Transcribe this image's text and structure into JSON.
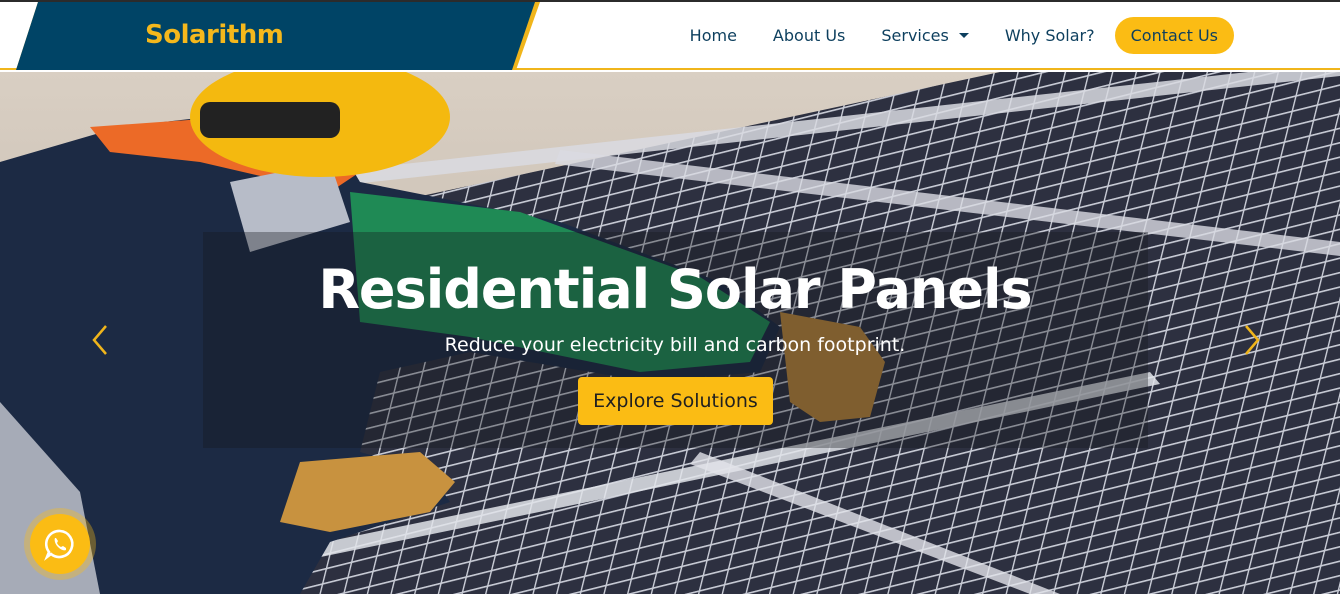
{
  "brand": {
    "name": "Solarithm"
  },
  "nav": {
    "home": "Home",
    "about": "About Us",
    "services": "Services",
    "why_solar": "Why Solar?",
    "contact": "Contact Us"
  },
  "hero": {
    "title": "Residential Solar Panels",
    "subtitle": "Reduce your electricity bill and carbon footprint.",
    "button": "Explore Solutions",
    "prev_icon": "chevron-left-icon",
    "next_icon": "chevron-right-icon"
  },
  "floating": {
    "icon": "whatsapp-icon"
  },
  "colors": {
    "navy": "#0d3f5e",
    "brand_block": "#004466",
    "accent": "#fbbc14"
  }
}
